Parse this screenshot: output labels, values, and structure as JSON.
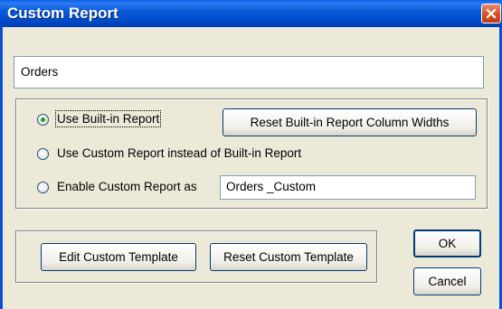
{
  "window": {
    "title": "Custom Report"
  },
  "report_name": "Orders",
  "options": [
    {
      "label": "Use Built-in Report",
      "selected": true
    },
    {
      "label": "Use Custom Report instead of Built-in Report",
      "selected": false
    },
    {
      "label": "Enable Custom Report as",
      "selected": false
    }
  ],
  "custom_report_name": "Orders _Custom",
  "buttons": {
    "reset_widths": "Reset Built-in Report Column Widths",
    "edit_template": "Edit Custom Template",
    "reset_template": "Reset Custom Template",
    "ok": "OK",
    "cancel": "Cancel"
  }
}
